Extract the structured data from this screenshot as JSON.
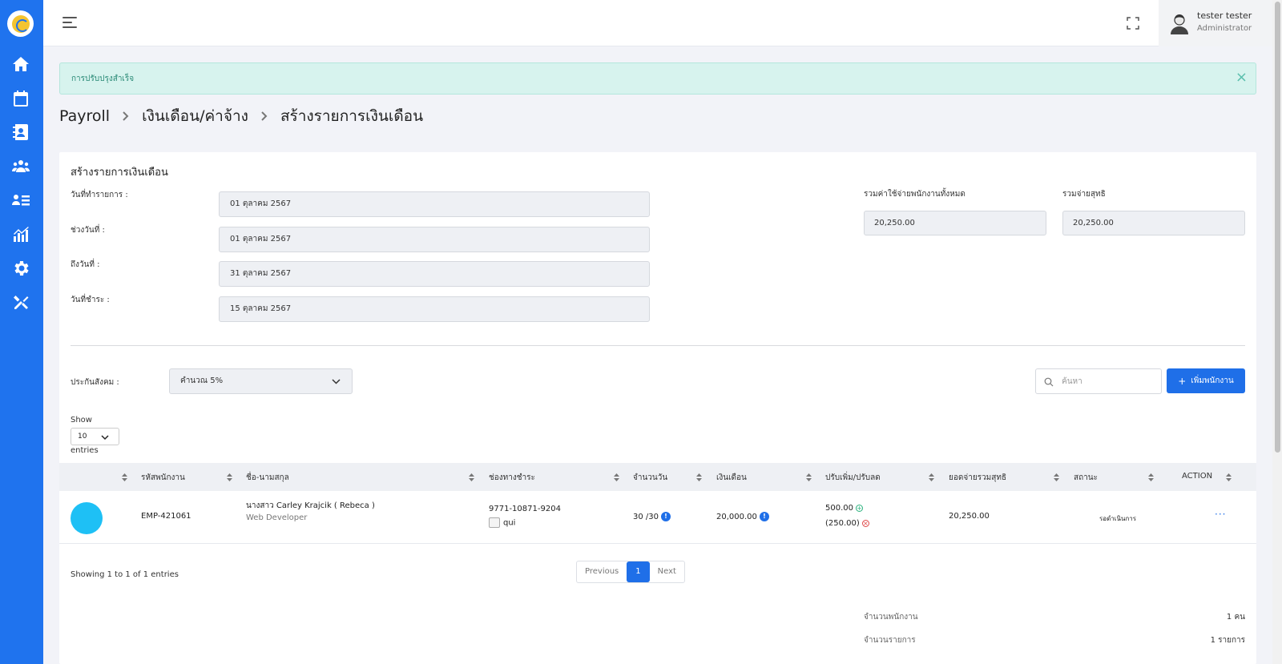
{
  "topbar": {
    "user_name": "tester tester",
    "user_role": "Administrator"
  },
  "alert": {
    "message": "การปรับปรุงสำเร็จ",
    "close": "×"
  },
  "breadcrumb": [
    "Payroll",
    "เงินเดือน/ค่าจ้าง",
    "สร้างรายการเงินเดือน"
  ],
  "form": {
    "title": "สร้างรายการเงินเดือน",
    "fields": [
      {
        "label": "วันที่ทำรายการ :",
        "value": "01 ตุลาคม 2567"
      },
      {
        "label": "ช่วงวันที่ :",
        "value": "01 ตุลาคม 2567"
      },
      {
        "label": "ถึงวันที่ :",
        "value": "31 ตุลาคม 2567"
      },
      {
        "label": "วันที่ชำระ :",
        "value": "15 ตุลาคม 2567"
      }
    ],
    "total_expense_label": "รวมค่าใช้จ่ายพนักงานทั้งหมด",
    "total_expense_value": "20,250.00",
    "net_pay_label": "รวมจ่ายสุทธิ",
    "net_pay_value": "20,250.00"
  },
  "controls": {
    "social_security_label": "ประกันสังคม :",
    "social_security_value": "คำนวณ 5%",
    "search_placeholder": "ค้นหา",
    "add_button": "เพิ่มพนักงาน",
    "show_label": "Show",
    "entries_value": "10",
    "entries_label": "entries"
  },
  "table": {
    "headers": [
      "",
      "รหัสพนักงาน",
      "ชื่อ-นามสกุล",
      "ช่องทางชำระ",
      "จำนวนวัน",
      "เงินเดือน",
      "ปรับเพิ่ม/ปรับลด",
      "ยอดจ่ายรวมสุทธิ",
      "สถานะ",
      "ACTION"
    ],
    "rows": [
      {
        "emp_id": "EMP-421061",
        "name": "นางสาว Carley Krajcik ( Rebeca )",
        "position": "Web Developer",
        "account": "9771-10871-9204",
        "bank_alt": "qui",
        "days": "30 /30",
        "salary": "20,000.00",
        "adjust_up": "500.00",
        "adjust_down": "(250.00)",
        "net": "20,250.00",
        "status": "รอดำเนินการ",
        "action": "···"
      }
    ]
  },
  "pagination": {
    "showing": "Showing 1 to 1 of 1 entries",
    "previous": "Previous",
    "page": "1",
    "next": "Next"
  },
  "summary": [
    {
      "label": "จำนวนพนักงาน",
      "value": "1 คน"
    },
    {
      "label": "จำนวนรายการ",
      "value": "1 รายการ"
    }
  ],
  "colors": {
    "sidebar": "#1f73ee",
    "primary": "#1f6fe8",
    "alert_bg": "#d7f3ee",
    "avatar": "#1ec0f5"
  }
}
